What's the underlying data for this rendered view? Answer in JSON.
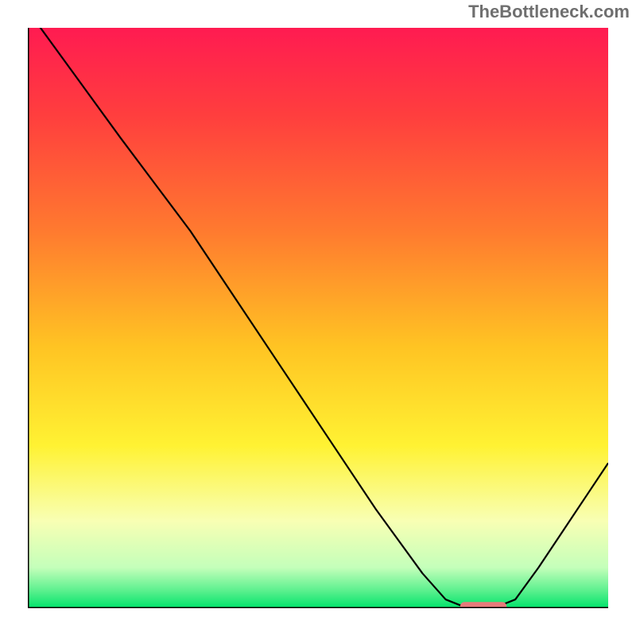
{
  "watermark": "TheBottleneck.com",
  "chart_data": {
    "type": "line",
    "xlim": [
      0,
      100
    ],
    "ylim": [
      0,
      100
    ],
    "title": "",
    "xlabel": "",
    "ylabel": "",
    "background_gradient_stops": [
      {
        "offset": 0.0,
        "color": "#ff1b51"
      },
      {
        "offset": 0.15,
        "color": "#ff3e3e"
      },
      {
        "offset": 0.35,
        "color": "#ff7a2f"
      },
      {
        "offset": 0.55,
        "color": "#ffc423"
      },
      {
        "offset": 0.72,
        "color": "#fff233"
      },
      {
        "offset": 0.85,
        "color": "#f8ffb4"
      },
      {
        "offset": 0.93,
        "color": "#c4ffba"
      },
      {
        "offset": 0.97,
        "color": "#5bf08e"
      },
      {
        "offset": 1.0,
        "color": "#00e36b"
      }
    ],
    "curve": [
      {
        "x": 0.0,
        "y": 103.0
      },
      {
        "x": 8.0,
        "y": 92.0
      },
      {
        "x": 16.0,
        "y": 81.0
      },
      {
        "x": 22.0,
        "y": 73.0
      },
      {
        "x": 28.0,
        "y": 65.0
      },
      {
        "x": 36.0,
        "y": 53.0
      },
      {
        "x": 44.0,
        "y": 41.0
      },
      {
        "x": 52.0,
        "y": 29.0
      },
      {
        "x": 60.0,
        "y": 17.0
      },
      {
        "x": 68.0,
        "y": 6.0
      },
      {
        "x": 72.0,
        "y": 1.5
      },
      {
        "x": 75.0,
        "y": 0.3
      },
      {
        "x": 81.0,
        "y": 0.3
      },
      {
        "x": 84.0,
        "y": 1.5
      },
      {
        "x": 88.0,
        "y": 7.0
      },
      {
        "x": 92.0,
        "y": 13.0
      },
      {
        "x": 96.0,
        "y": 19.0
      },
      {
        "x": 100.0,
        "y": 25.0
      }
    ],
    "marker": {
      "x_start": 74.5,
      "x_end": 82.5,
      "y": 0.3,
      "color": "#e77b7b"
    }
  }
}
